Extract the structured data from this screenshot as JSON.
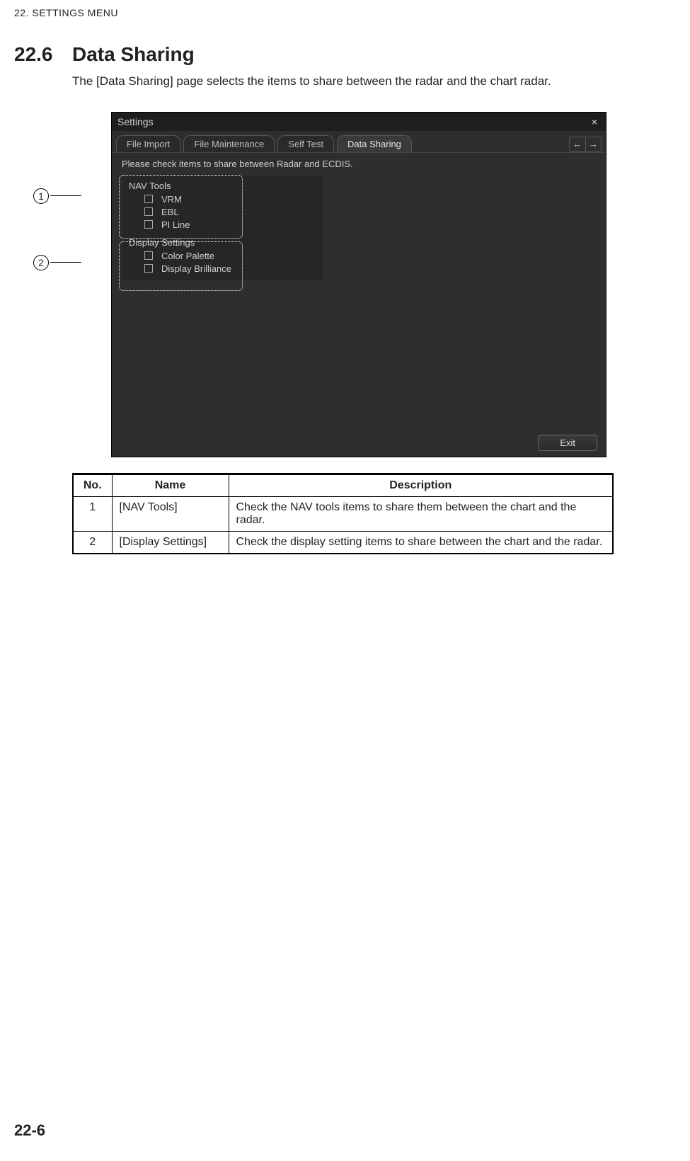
{
  "runhead": "22.  SETTINGS MENU",
  "section_number": "22.6",
  "section_title": "Data Sharing",
  "body_paragraph": "The [Data Sharing] page selects the items to share between the radar and the chart radar.",
  "settings_window": {
    "title": "Settings",
    "tabs": [
      "File Import",
      "File Maintenance",
      "Self Test",
      "Data Sharing"
    ],
    "active_tab_index": 3,
    "instruction": "Please check items to share between Radar and ECDIS.",
    "groups": [
      {
        "label": "NAV Tools",
        "items": [
          "VRM",
          "EBL",
          "PI Line"
        ]
      },
      {
        "label": "Display Settings",
        "items": [
          "Color Palette",
          "Display Brilliance"
        ]
      }
    ],
    "exit_label": "Exit"
  },
  "callouts": [
    "1",
    "2"
  ],
  "table": {
    "headers": [
      "No.",
      "Name",
      "Description"
    ],
    "rows": [
      {
        "no": "1",
        "name": "[NAV Tools]",
        "desc": "Check the NAV tools items to share them between the chart and the radar."
      },
      {
        "no": "2",
        "name": "[Display Settings]",
        "desc": "Check the display setting items to share between the chart and the radar."
      }
    ]
  },
  "page_number": "22-6"
}
